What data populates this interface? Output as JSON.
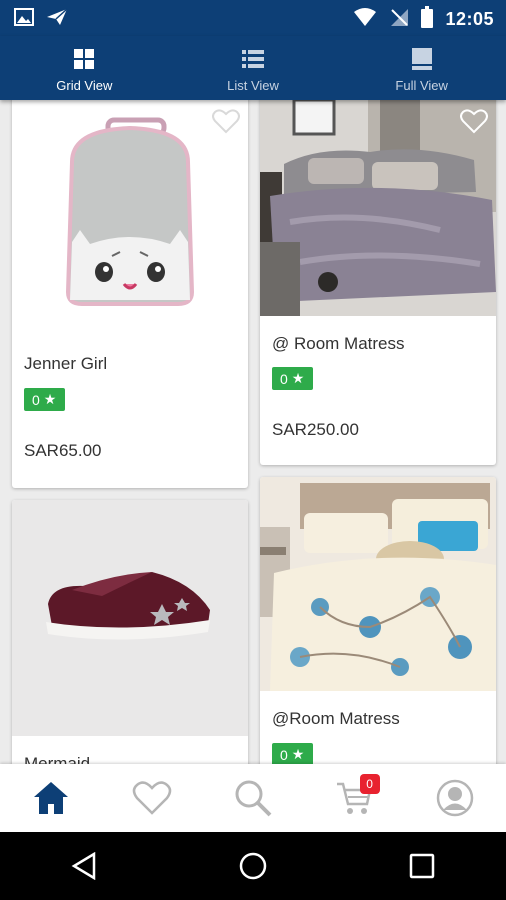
{
  "status_bar": {
    "time": "12:05"
  },
  "view_tabs": [
    {
      "label": "Grid View"
    },
    {
      "label": "List View"
    },
    {
      "label": "Full View"
    }
  ],
  "products": [
    {
      "title": "Jenner Girl",
      "rating": "0",
      "price": "SAR65.00"
    },
    {
      "title": "@ Room Matress",
      "rating": "0",
      "price": "SAR250.00"
    },
    {
      "title": "Mermaid"
    },
    {
      "title": "@Room Matress",
      "rating": "0"
    }
  ],
  "bottom_nav": {
    "cart_count": "0"
  },
  "colors": {
    "primary": "#0d3f76",
    "rating_green": "#2eab4a",
    "badge_red": "#e8222f"
  }
}
